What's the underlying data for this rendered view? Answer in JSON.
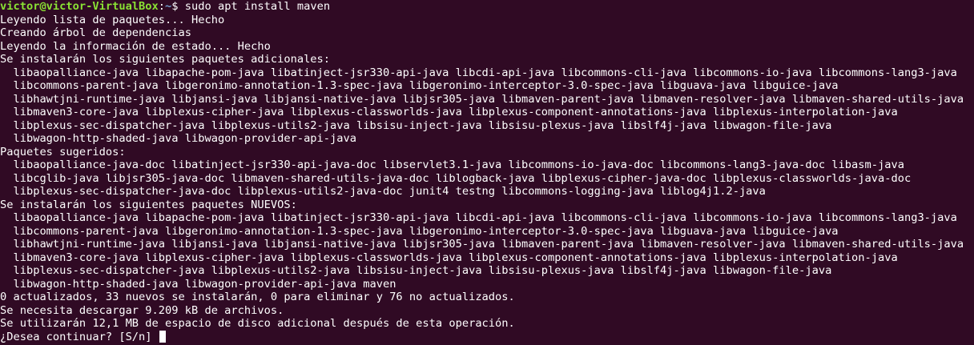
{
  "prompt": {
    "user_host": "victor@victor-VirtualBox",
    "separator": ":",
    "path": "~",
    "symbol": "$ ",
    "command": "sudo apt install maven"
  },
  "output_lines": [
    "Leyendo lista de paquetes... Hecho",
    "Creando árbol de dependencias",
    "Leyendo la información de estado... Hecho",
    "Se instalarán los siguientes paquetes adicionales:",
    "  libaopalliance-java libapache-pom-java libatinject-jsr330-api-java libcdi-api-java libcommons-cli-java libcommons-io-java libcommons-lang3-java",
    "  libcommons-parent-java libgeronimo-annotation-1.3-spec-java libgeronimo-interceptor-3.0-spec-java libguava-java libguice-java",
    "  libhawtjni-runtime-java libjansi-java libjansi-native-java libjsr305-java libmaven-parent-java libmaven-resolver-java libmaven-shared-utils-java",
    "  libmaven3-core-java libplexus-cipher-java libplexus-classworlds-java libplexus-component-annotations-java libplexus-interpolation-java",
    "  libplexus-sec-dispatcher-java libplexus-utils2-java libsisu-inject-java libsisu-plexus-java libslf4j-java libwagon-file-java",
    "  libwagon-http-shaded-java libwagon-provider-api-java",
    "Paquetes sugeridos:",
    "  libaopalliance-java-doc libatinject-jsr330-api-java-doc libservlet3.1-java libcommons-io-java-doc libcommons-lang3-java-doc libasm-java",
    "  libcglib-java libjsr305-java-doc libmaven-shared-utils-java-doc liblogback-java libplexus-cipher-java-doc libplexus-classworlds-java-doc",
    "  libplexus-sec-dispatcher-java-doc libplexus-utils2-java-doc junit4 testng libcommons-logging-java liblog4j1.2-java",
    "Se instalarán los siguientes paquetes NUEVOS:",
    "  libaopalliance-java libapache-pom-java libatinject-jsr330-api-java libcdi-api-java libcommons-cli-java libcommons-io-java libcommons-lang3-java",
    "  libcommons-parent-java libgeronimo-annotation-1.3-spec-java libgeronimo-interceptor-3.0-spec-java libguava-java libguice-java",
    "  libhawtjni-runtime-java libjansi-java libjansi-native-java libjsr305-java libmaven-parent-java libmaven-resolver-java libmaven-shared-utils-java",
    "  libmaven3-core-java libplexus-cipher-java libplexus-classworlds-java libplexus-component-annotations-java libplexus-interpolation-java",
    "  libplexus-sec-dispatcher-java libplexus-utils2-java libsisu-inject-java libsisu-plexus-java libslf4j-java libwagon-file-java",
    "  libwagon-http-shaded-java libwagon-provider-api-java maven",
    "0 actualizados, 33 nuevos se instalarán, 0 para eliminar y 76 no actualizados.",
    "Se necesita descargar 9.209 kB de archivos.",
    "Se utilizarán 12,1 MB de espacio de disco adicional después de esta operación."
  ],
  "input_prompt": "¿Desea continuar? [S/n] ",
  "colors": {
    "background": "#300a24",
    "text": "#ffffff",
    "prompt_user": "#8ae234",
    "prompt_path": "#729fcf"
  }
}
